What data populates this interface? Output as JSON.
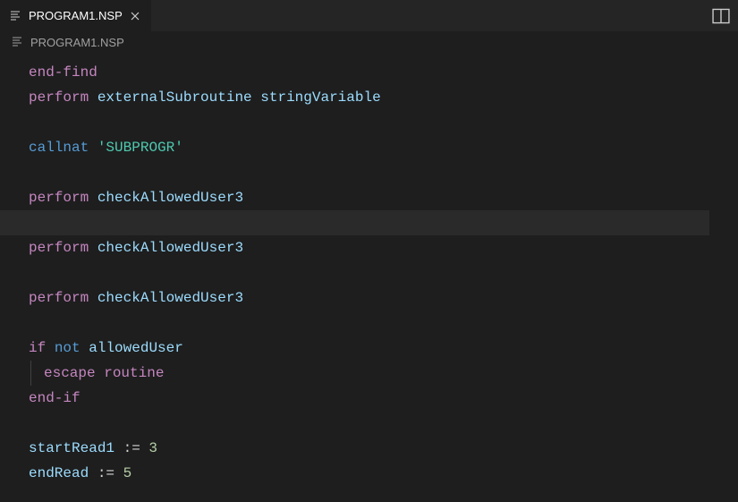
{
  "tab": {
    "name": "PROGRAM1.NSP"
  },
  "breadcrumb": {
    "name": "PROGRAM1.NSP"
  },
  "code": {
    "line1_kw": "end-find",
    "line2_kw": "perform",
    "line2_id1": "externalSubroutine",
    "line2_id2": "stringVariable",
    "line4_kw": "callnat",
    "line4_str": "'SUBPROGR'",
    "line6_kw": "perform",
    "line6_id": "checkAllowedUser3",
    "line8_kw": "perform",
    "line8_id": "checkAllowedUser3",
    "line10_kw": "perform",
    "line10_id": "checkAllowedUser3",
    "line12_if": "if",
    "line12_not": "not",
    "line12_id": "allowedUser",
    "line13_escape": "escape",
    "line13_routine": "routine",
    "line14_endif": "end-if",
    "line16_id": "startRead1",
    "line16_op": " := ",
    "line16_num": "3",
    "line17_id": "endRead",
    "line17_op": " := ",
    "line17_num": "5"
  }
}
